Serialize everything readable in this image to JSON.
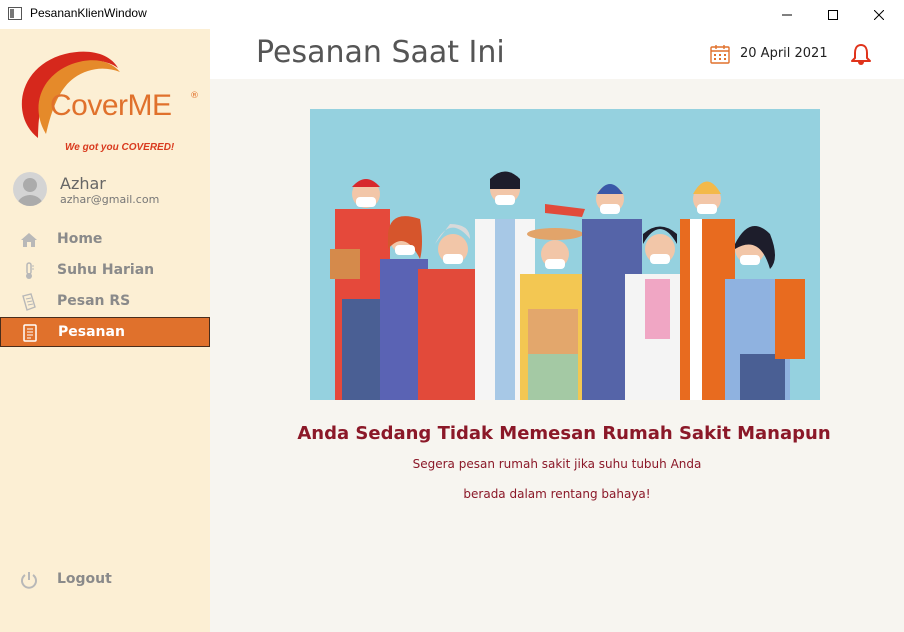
{
  "window": {
    "title": "PesananKlienWindow"
  },
  "brand": {
    "name": "CoverME",
    "reg": "®",
    "tagline": "We got you COVERED!"
  },
  "user": {
    "name": "Azhar",
    "email": "azhar@gmail.com"
  },
  "nav": {
    "items": [
      {
        "label": "Home",
        "icon": "home-icon",
        "active": false
      },
      {
        "label": "Suhu Harian",
        "icon": "thermometer-icon",
        "active": false
      },
      {
        "label": "Pesan RS",
        "icon": "document-icon",
        "active": false
      },
      {
        "label": "Pesanan",
        "icon": "list-icon",
        "active": true
      }
    ],
    "logout": {
      "label": "Logout",
      "icon": "power-icon"
    }
  },
  "header": {
    "title": "Pesanan Saat Ini",
    "date": "20 April 2021",
    "calendar_icon": "calendar-icon",
    "bell_icon": "bell-icon"
  },
  "main": {
    "message_title": "Anda Sedang Tidak Memesan Rumah Sakit Manapun",
    "message_line1": "Segera pesan rumah sakit jika suhu tubuh Anda",
    "message_line2": "berada dalam rentang bahaya!"
  },
  "colors": {
    "accent": "#e0712c",
    "sidebar_bg": "#fcefd4",
    "message": "#8b1828",
    "illustration_bg": "#95d1df"
  }
}
